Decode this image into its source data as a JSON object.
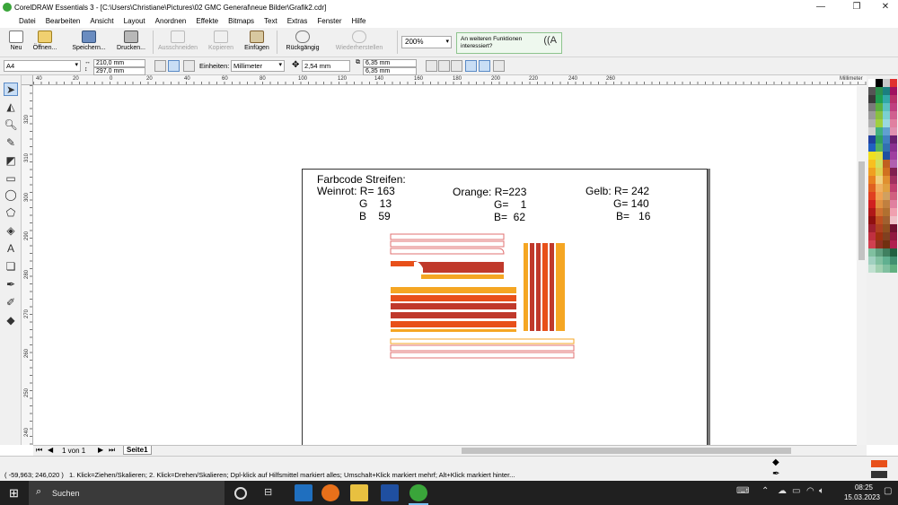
{
  "window": {
    "title": "CorelDRAW Essentials 3 - [C:\\Users\\Christiane\\Pictures\\02 GMC General\\neue Bilder\\Grafik2.cdr]",
    "minimize_glyph": "—",
    "restore_glyph": "❐",
    "close_glyph": "✕"
  },
  "menu": [
    "Datei",
    "Bearbeiten",
    "Ansicht",
    "Layout",
    "Anordnen",
    "Effekte",
    "Bitmaps",
    "Text",
    "Extras",
    "Fenster",
    "Hilfe"
  ],
  "toolbar": {
    "new": "Neu",
    "open": "Öffnen...",
    "save": "Speichern...",
    "print": "Drucken...",
    "cut": "Ausschneiden",
    "copy": "Kopieren",
    "paste": "Einfügen",
    "undo": "Rückgängig",
    "redo": "Wiederherstellen",
    "zoom": "200%",
    "hint_text": "An weiteren Funktionen interessiert?"
  },
  "propbar": {
    "page_size": "A4",
    "width": "210,0 mm",
    "height": "297,0 mm",
    "units_label": "Einheiten:",
    "units": "Millimeter",
    "nudge": "2,54 mm",
    "dup_x": "6,35 mm",
    "dup_y": "6,35 mm"
  },
  "ruler": {
    "h_ticks": [
      "40",
      "20",
      "0",
      "20",
      "40",
      "60",
      "80",
      "100",
      "120",
      "140",
      "160",
      "180",
      "200",
      "220",
      "240",
      "260"
    ],
    "v_ticks": [
      "320",
      "310",
      "300",
      "290",
      "280",
      "270",
      "260",
      "250",
      "240",
      "230"
    ],
    "units": "Millimeter"
  },
  "page": {
    "heading": "Farbcode Streifen:",
    "weinrot": [
      "Weinrot: R= 163",
      "G    13",
      "B    59"
    ],
    "orange": [
      "Orange: R=223",
      "G=    1",
      "B=  62"
    ],
    "gelb": [
      "Gelb: R= 242",
      "G= 140",
      "B=   16"
    ]
  },
  "colors": {
    "weinrot": "#c0392b",
    "orange": "#e8501a",
    "gelb": "#f5a623",
    "outline": "#e07070"
  },
  "pagenav": {
    "page_count": "1 von 1",
    "tab": "Seite1"
  },
  "status": {
    "coords": "( -59,963; 246,020 )",
    "hint": "1. Klick=Ziehen/Skalieren; 2. Klick=Drehen/Skalieren; Dpl-klick auf Hilfsmittel markiert alles; Umschalt+Klick markiert mehrf; Alt+Klick markiert hinter..."
  },
  "taskbar": {
    "search": "Suchen",
    "time": "08:25",
    "date": "15.03.2023"
  },
  "palette": [
    [
      "#ffffff",
      "#000000",
      "#c8c8c8",
      "#e03030"
    ],
    [
      "#555555",
      "#2d8f4e",
      "#1a7f7f",
      "#a01060"
    ],
    [
      "#3a3a3a",
      "#1f9f50",
      "#31a8a8",
      "#b8306a"
    ],
    [
      "#7a7a7a",
      "#5ab040",
      "#5ac0c0",
      "#c04080"
    ],
    [
      "#9a9a9a",
      "#8ac040",
      "#7ad0d0",
      "#d06090"
    ],
    [
      "#b0b0b0",
      "#a0d040",
      "#9ad8e0",
      "#e080a0"
    ],
    [
      "#d0d0d0",
      "#40b080",
      "#60a0d0",
      "#e090b0"
    ],
    [
      "#2040a0",
      "#30a060",
      "#4080c0",
      "#6a2070"
    ],
    [
      "#2060c0",
      "#50b060",
      "#3070b0",
      "#8a3090"
    ],
    [
      "#f0e020",
      "#e0e040",
      "#2050a0",
      "#a040a0"
    ],
    [
      "#f8c020",
      "#d0e060",
      "#c06020",
      "#b060b0"
    ],
    [
      "#f0a020",
      "#e0d050",
      "#d07020",
      "#802050"
    ],
    [
      "#e88020",
      "#f0d080",
      "#e09030",
      "#a03060"
    ],
    [
      "#e06020",
      "#f0b060",
      "#e0a040",
      "#c04070"
    ],
    [
      "#e04020",
      "#f0a050",
      "#d0a060",
      "#d06080"
    ],
    [
      "#d02020",
      "#e09040",
      "#c08040",
      "#e080a0"
    ],
    [
      "#b01818",
      "#d07030",
      "#b07030",
      "#f0a0b0"
    ],
    [
      "#901010",
      "#c05020",
      "#a06030",
      "#f0c0c8"
    ],
    [
      "#a02030",
      "#b04020",
      "#905020",
      "#701030"
    ],
    [
      "#c03040",
      "#a03010",
      "#804020",
      "#901840"
    ],
    [
      "#d04050",
      "#903020",
      "#703010",
      "#b02050"
    ],
    [
      "#80c0a0",
      "#60a080",
      "#408060",
      "#206040"
    ],
    [
      "#a0d0c0",
      "#80c0a0",
      "#60b090",
      "#409070"
    ],
    [
      "#c0e0d0",
      "#a0d0b0",
      "#80c0a0",
      "#60b080"
    ]
  ]
}
